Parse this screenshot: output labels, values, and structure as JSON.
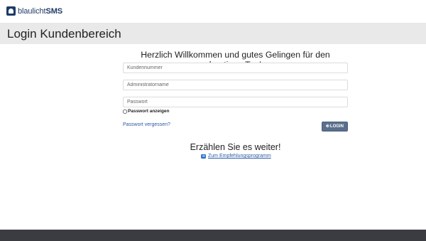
{
  "brand": {
    "name_light": "blaulicht",
    "name_bold": "SMS"
  },
  "header": {
    "title": "Login Kundenbereich"
  },
  "login": {
    "welcome": "Herzlich Willkommen und gutes Gelingen für den heutigen Tag!",
    "customer_number_placeholder": "Kundennummer",
    "admin_name_placeholder": "Administratorname",
    "password_placeholder": "Passwort",
    "show_password_label": "Passwort anzeigen",
    "forgot_password_link": "Passwort vergessen?",
    "login_button": "LOGIN"
  },
  "referral": {
    "heading": "Erzählen Sie es weiter!",
    "link": "Zum Empfehlungsprogramm"
  },
  "colors": {
    "brand": "#1f3b66",
    "button": "#5a6f8c",
    "link": "#2d5aa8",
    "footer": "#3a3c41",
    "title_bar": "#e9e9e9"
  }
}
